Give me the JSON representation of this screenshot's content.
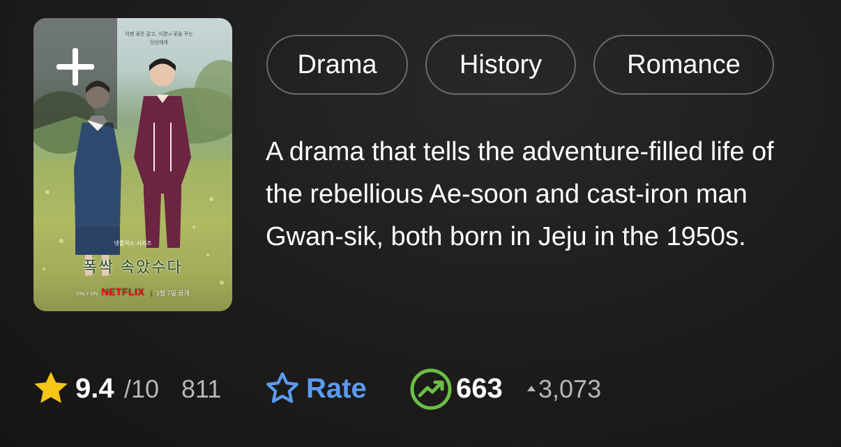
{
  "poster": {
    "tagline_line1": "이젠 꽃은 같고, 이겼나 꽃을 꾸는",
    "tagline_line2": "당신에게",
    "series_label": "넷플릭스 시리즈",
    "korean_title": "폭싹 속았수다",
    "only_on": "ONLY ON",
    "brand": "NETFLIX",
    "release": "3월 7일 공개",
    "watchlist_icon": "plus-icon"
  },
  "genres": [
    "Drama",
    "History",
    "Romance"
  ],
  "description": "A drama that tells the adventure-filled life of the rebellious Ae-soon and cast-iron man Gwan-sik, both born in Jeju in the 1950s.",
  "rating": {
    "icon": "star-icon",
    "value": "9.4",
    "max": "/10",
    "count": "811"
  },
  "rate": {
    "icon": "star-outline-icon",
    "label": "Rate"
  },
  "popularity": {
    "icon": "trending-up-icon",
    "rank": "663",
    "trend_icon": "triangle-up-icon",
    "delta": "3,073"
  },
  "colors": {
    "star": "#f5c518",
    "rate": "#5b9bef",
    "popularity": "#6cbe45"
  }
}
